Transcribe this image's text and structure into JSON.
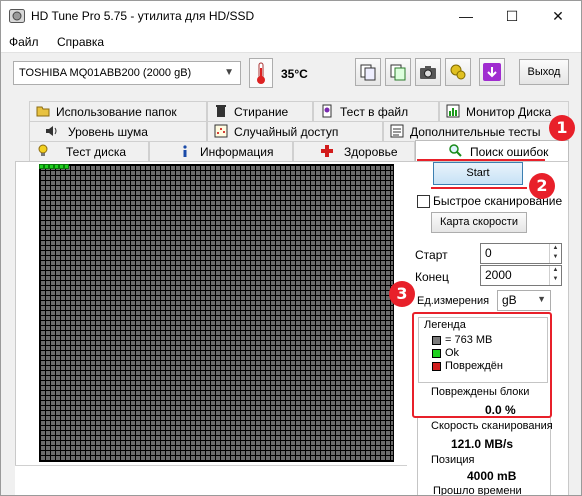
{
  "window": {
    "title": "HD Tune Pro 5.75 - утилита для HD/SSD",
    "controls": {
      "minimize": "—",
      "maximize": "☐",
      "close": "✕"
    }
  },
  "menu": [
    "Файл",
    "Справка"
  ],
  "toolbar": {
    "drive": "TOSHIBA MQ01ABB200 (2000 gB)",
    "temperature": "35°C",
    "exit_label": "Выход",
    "icons": [
      "copy-icon",
      "copy-text-icon",
      "camera-icon",
      "options-icon",
      "save-icon"
    ]
  },
  "tabs": {
    "row1": [
      "Использование папок",
      "Стирание",
      "Тест в файл",
      "Монитор Диска"
    ],
    "row2": [
      "Уровень шума",
      "Случайный доступ",
      "Дополнительные тесты"
    ],
    "row3": [
      "Тест диска",
      "Информация",
      "Здоровье",
      "Поиск ошибок"
    ],
    "active": "Поиск ошибок"
  },
  "scan": {
    "start_label": "Start",
    "quick_scan_label": "Быстрое сканирование",
    "quick_scan_checked": false,
    "speed_map_label": "Карта скорости",
    "start_field_label": "Старт",
    "start_value": "0",
    "end_field_label": "Конец",
    "end_value": "2000",
    "unit_label": "Ед.измерения",
    "unit_value": "gB"
  },
  "legend": {
    "title": "Легенда",
    "items": [
      {
        "label": "= 763 MB",
        "color": "#7a7a7a"
      },
      {
        "label": "Ok",
        "color": "#1fd01f"
      },
      {
        "label": "Повреждён",
        "color": "#d01f1f"
      }
    ]
  },
  "damaged": {
    "title": "Повреждены блоки",
    "value": "0.0 %"
  },
  "stats": {
    "speed_label": "Скорость сканирования",
    "speed_value": "121.0 MB/s",
    "position_label": "Позиция",
    "position_value": "4000 mB",
    "elapsed_label": "Прошло времени"
  },
  "annotations": [
    "1",
    "2",
    "3"
  ],
  "colors": {
    "annotation_red": "#e8202a",
    "ok_green": "#1fd01f",
    "grid_gray": "#6b6b6b"
  }
}
